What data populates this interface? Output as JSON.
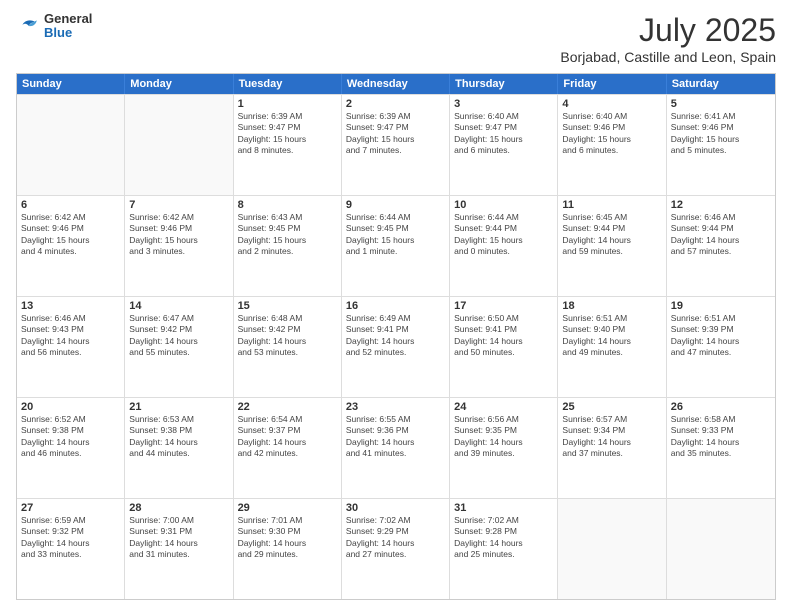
{
  "header": {
    "logo_general": "General",
    "logo_blue": "Blue",
    "title": "July 2025",
    "subtitle": "Borjabad, Castille and Leon, Spain"
  },
  "weekdays": [
    "Sunday",
    "Monday",
    "Tuesday",
    "Wednesday",
    "Thursday",
    "Friday",
    "Saturday"
  ],
  "weeks": [
    [
      {
        "day": "",
        "detail": ""
      },
      {
        "day": "",
        "detail": ""
      },
      {
        "day": "1",
        "detail": "Sunrise: 6:39 AM\nSunset: 9:47 PM\nDaylight: 15 hours\nand 8 minutes."
      },
      {
        "day": "2",
        "detail": "Sunrise: 6:39 AM\nSunset: 9:47 PM\nDaylight: 15 hours\nand 7 minutes."
      },
      {
        "day": "3",
        "detail": "Sunrise: 6:40 AM\nSunset: 9:47 PM\nDaylight: 15 hours\nand 6 minutes."
      },
      {
        "day": "4",
        "detail": "Sunrise: 6:40 AM\nSunset: 9:46 PM\nDaylight: 15 hours\nand 6 minutes."
      },
      {
        "day": "5",
        "detail": "Sunrise: 6:41 AM\nSunset: 9:46 PM\nDaylight: 15 hours\nand 5 minutes."
      }
    ],
    [
      {
        "day": "6",
        "detail": "Sunrise: 6:42 AM\nSunset: 9:46 PM\nDaylight: 15 hours\nand 4 minutes."
      },
      {
        "day": "7",
        "detail": "Sunrise: 6:42 AM\nSunset: 9:46 PM\nDaylight: 15 hours\nand 3 minutes."
      },
      {
        "day": "8",
        "detail": "Sunrise: 6:43 AM\nSunset: 9:45 PM\nDaylight: 15 hours\nand 2 minutes."
      },
      {
        "day": "9",
        "detail": "Sunrise: 6:44 AM\nSunset: 9:45 PM\nDaylight: 15 hours\nand 1 minute."
      },
      {
        "day": "10",
        "detail": "Sunrise: 6:44 AM\nSunset: 9:44 PM\nDaylight: 15 hours\nand 0 minutes."
      },
      {
        "day": "11",
        "detail": "Sunrise: 6:45 AM\nSunset: 9:44 PM\nDaylight: 14 hours\nand 59 minutes."
      },
      {
        "day": "12",
        "detail": "Sunrise: 6:46 AM\nSunset: 9:44 PM\nDaylight: 14 hours\nand 57 minutes."
      }
    ],
    [
      {
        "day": "13",
        "detail": "Sunrise: 6:46 AM\nSunset: 9:43 PM\nDaylight: 14 hours\nand 56 minutes."
      },
      {
        "day": "14",
        "detail": "Sunrise: 6:47 AM\nSunset: 9:42 PM\nDaylight: 14 hours\nand 55 minutes."
      },
      {
        "day": "15",
        "detail": "Sunrise: 6:48 AM\nSunset: 9:42 PM\nDaylight: 14 hours\nand 53 minutes."
      },
      {
        "day": "16",
        "detail": "Sunrise: 6:49 AM\nSunset: 9:41 PM\nDaylight: 14 hours\nand 52 minutes."
      },
      {
        "day": "17",
        "detail": "Sunrise: 6:50 AM\nSunset: 9:41 PM\nDaylight: 14 hours\nand 50 minutes."
      },
      {
        "day": "18",
        "detail": "Sunrise: 6:51 AM\nSunset: 9:40 PM\nDaylight: 14 hours\nand 49 minutes."
      },
      {
        "day": "19",
        "detail": "Sunrise: 6:51 AM\nSunset: 9:39 PM\nDaylight: 14 hours\nand 47 minutes."
      }
    ],
    [
      {
        "day": "20",
        "detail": "Sunrise: 6:52 AM\nSunset: 9:38 PM\nDaylight: 14 hours\nand 46 minutes."
      },
      {
        "day": "21",
        "detail": "Sunrise: 6:53 AM\nSunset: 9:38 PM\nDaylight: 14 hours\nand 44 minutes."
      },
      {
        "day": "22",
        "detail": "Sunrise: 6:54 AM\nSunset: 9:37 PM\nDaylight: 14 hours\nand 42 minutes."
      },
      {
        "day": "23",
        "detail": "Sunrise: 6:55 AM\nSunset: 9:36 PM\nDaylight: 14 hours\nand 41 minutes."
      },
      {
        "day": "24",
        "detail": "Sunrise: 6:56 AM\nSunset: 9:35 PM\nDaylight: 14 hours\nand 39 minutes."
      },
      {
        "day": "25",
        "detail": "Sunrise: 6:57 AM\nSunset: 9:34 PM\nDaylight: 14 hours\nand 37 minutes."
      },
      {
        "day": "26",
        "detail": "Sunrise: 6:58 AM\nSunset: 9:33 PM\nDaylight: 14 hours\nand 35 minutes."
      }
    ],
    [
      {
        "day": "27",
        "detail": "Sunrise: 6:59 AM\nSunset: 9:32 PM\nDaylight: 14 hours\nand 33 minutes."
      },
      {
        "day": "28",
        "detail": "Sunrise: 7:00 AM\nSunset: 9:31 PM\nDaylight: 14 hours\nand 31 minutes."
      },
      {
        "day": "29",
        "detail": "Sunrise: 7:01 AM\nSunset: 9:30 PM\nDaylight: 14 hours\nand 29 minutes."
      },
      {
        "day": "30",
        "detail": "Sunrise: 7:02 AM\nSunset: 9:29 PM\nDaylight: 14 hours\nand 27 minutes."
      },
      {
        "day": "31",
        "detail": "Sunrise: 7:02 AM\nSunset: 9:28 PM\nDaylight: 14 hours\nand 25 minutes."
      },
      {
        "day": "",
        "detail": ""
      },
      {
        "day": "",
        "detail": ""
      }
    ]
  ]
}
